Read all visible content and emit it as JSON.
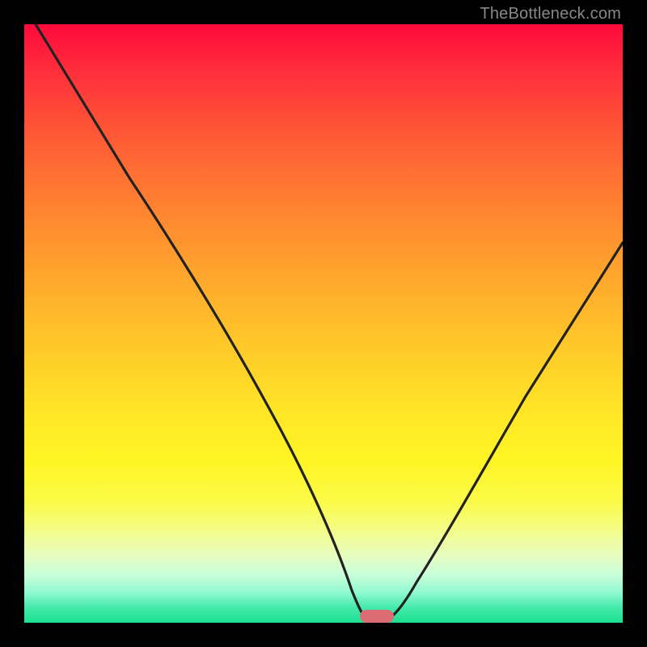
{
  "watermark": "TheBottleneck.com",
  "colors": {
    "background": "#000000",
    "gradient_top": "#ff0a3c",
    "gradient_bottom": "#1be090",
    "curve": "#222222",
    "marker": "#dd6b74"
  },
  "chart_data": {
    "type": "line",
    "title": "",
    "xlabel": "",
    "ylabel": "",
    "xlim": [
      0,
      100
    ],
    "ylim": [
      0,
      100
    ],
    "grid": false,
    "legend": false,
    "series": [
      {
        "name": "bottleneck-curve",
        "x": [
          2,
          8,
          15,
          22,
          30,
          38,
          45,
          52,
          55,
          57,
          58,
          59,
          62,
          65,
          70,
          76,
          83,
          90,
          97,
          100
        ],
        "y": [
          100,
          90,
          80,
          71,
          61,
          49,
          37,
          17,
          6,
          1,
          0,
          0,
          1,
          4,
          11,
          22,
          36,
          49,
          60,
          64
        ]
      }
    ],
    "marker": {
      "x": 58.5,
      "y": 0,
      "width_pct": 5.7
    }
  }
}
